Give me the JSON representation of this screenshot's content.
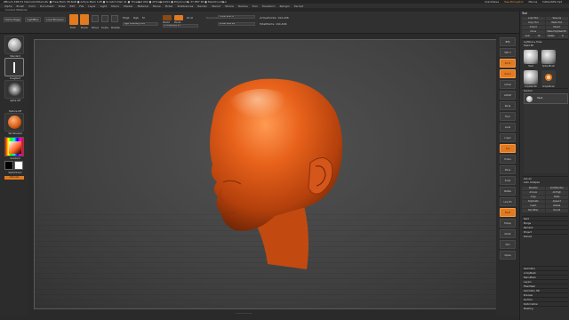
{
  "title_bar": {
    "title": "ZBrush 4R6 P1    Demo/Untitled.zbr    ● Free Mem 48.6GB ● Active Mem 128 ● Scratch Disk 41 ● Timer▶0.002 ● ATime▶0.001 ● PolyCount▶ 37.887 KP ● MeshCount▶1",
    "right_items": [
      "QuickSave",
      "See-through  0",
      "Menus",
      "DefaultZScript"
    ]
  },
  "menu": [
    "Alpha",
    "Brush",
    "Color",
    "Document",
    "Draw",
    "Edit",
    "File",
    "Layer",
    "Light",
    "Macro",
    "Marker",
    "Material",
    "Movie",
    "Picker",
    "Preferences",
    "Render",
    "Stencil",
    "Stroke",
    "Texture",
    "Tool",
    "Transform",
    "Zplugin",
    "Zscript"
  ],
  "status": "Current Material",
  "shelf": {
    "home_page": "Home Page",
    "lightbox": "LightBox",
    "live_boolean": "Live Boolean",
    "edit": "Edit",
    "draw": "Draw",
    "move": "Move",
    "scale": "Scale",
    "rotate": "Rotate",
    "mrgb": "Mrgb",
    "rgb": "Rgb",
    "m": "M",
    "zadd": "Zadd",
    "zsub": "Zsub",
    "zcut": "Zcut",
    "rgb_intensity": "Rgb Intensity 100",
    "z_intensity": "Z Intensity 25",
    "focal_shift": "Focal Shift 0",
    "draw_size": "Draw Size 64",
    "dynamic": "Dynamic",
    "active_points": "ActivePoints: 194,406",
    "total_points": "TotalPoints: 194,406"
  },
  "left_shelf": {
    "slots": [
      "Standard",
      "DragRect",
      "Alpha Off",
      "Texture Off",
      "SkinShade4"
    ],
    "gradient_label": "Gradient",
    "switch_color": "SwitchColor",
    "alternate": "Alternate"
  },
  "right_shelf": [
    "BPR",
    "SPix 3",
    "Scroll",
    "Zoom",
    "Actual",
    "AAHalf",
    "Persp",
    "Floor",
    "Local",
    "L.Sym",
    "Xyz",
    "Frame",
    "Move",
    "Scale",
    "Rotate",
    "Line Fill",
    "PolyF",
    "Transp",
    "Ghost",
    "Solo",
    "Xpose"
  ],
  "tray": {
    "title": "Tool",
    "buttons": [
      [
        "Load Tool",
        "Save As"
      ],
      [
        "Copy Tool",
        "Paste Tool"
      ],
      [
        "Import",
        "Export"
      ],
      [
        "Clone",
        "Make PolyMesh3D"
      ],
      [
        "GoZ",
        "All",
        "Visible",
        "R"
      ]
    ],
    "lightbox_tools": "Lightbox ▸ Tools",
    "current_tool": "Head  48",
    "thumbs": [
      "Head",
      "SphereBrush",
      "PolyMesh3D",
      "SimpleBrush"
    ],
    "subtool": "Subtool",
    "subtool_item": "Head",
    "sections": [
      "Geometry",
      "ArrayMesh",
      "NanoMesh",
      "Layers",
      "FiberMesh",
      "Geometry HD",
      "Preview",
      "Surface",
      "Deformation",
      "Masking"
    ],
    "list_items": [
      "List All",
      "Auto Collapse",
      "Rename",
      "AutoReorder",
      "All Low",
      "All High",
      "Copy",
      "Paste",
      "Duplicate",
      "Append",
      "Insert",
      "Delete",
      "Del Other",
      "Del All",
      "Split",
      "Merge",
      "Remesh",
      "Project",
      "Extract"
    ]
  },
  "canvas_bottom": "———————"
}
